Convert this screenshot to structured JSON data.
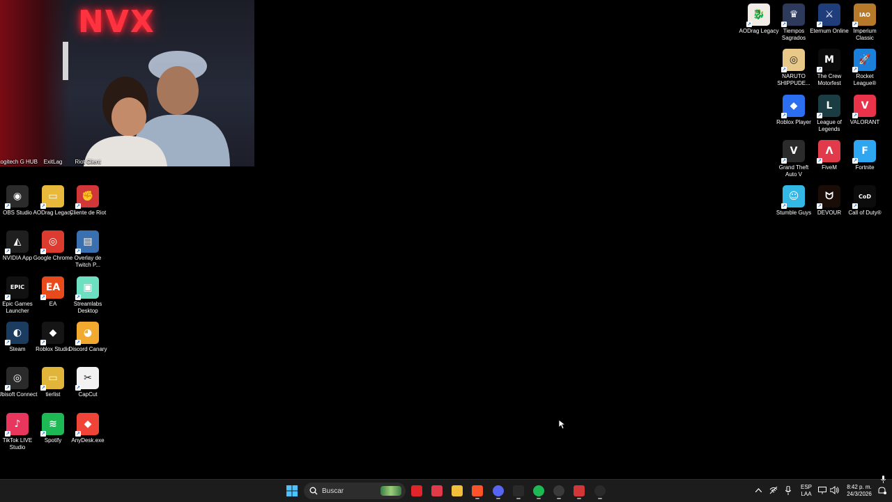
{
  "webcam": {
    "neon_sign": "NVX"
  },
  "left_icons": [
    {
      "label": "Logitech G HUB",
      "color": "#0a0a0a",
      "glyph": "G"
    },
    {
      "label": "ExitLag",
      "color": "#1a1a1a",
      "glyph": "X"
    },
    {
      "label": "Riot Client",
      "color": "#d13639",
      "glyph": "R"
    },
    {
      "label": "OBS Studio",
      "color": "#2b2b2b",
      "glyph": "◉"
    },
    {
      "label": "AODrag Legacy",
      "color": "#e8b93a",
      "glyph": "▭"
    },
    {
      "label": "Cliente de Riot",
      "color": "#d13639",
      "glyph": "✊"
    },
    {
      "label": "NVIDIA App",
      "color": "#1f1f1f",
      "glyph": "◭"
    },
    {
      "label": "Google Chrome",
      "color": "#dd3b30",
      "glyph": "◎"
    },
    {
      "label": "Overlay de Twitch P...",
      "color": "#3a6fb0",
      "glyph": "▤"
    },
    {
      "label": "Epic Games Launcher",
      "color": "#111111",
      "glyph": "EPIC"
    },
    {
      "label": "EA",
      "color": "#e84a1c",
      "glyph": "EA"
    },
    {
      "label": "Streamlabs Desktop",
      "color": "#6ee0c2",
      "glyph": "▣"
    },
    {
      "label": "Steam",
      "color": "#1b3c5f",
      "glyph": "◐"
    },
    {
      "label": "Roblox Studio",
      "color": "#151515",
      "glyph": "◆"
    },
    {
      "label": "Discord Canary",
      "color": "#f2a930",
      "glyph": "◕"
    },
    {
      "label": "Ubisoft Connect",
      "color": "#2a2a2a",
      "glyph": "◎"
    },
    {
      "label": "tierlist",
      "color": "#e0b53a",
      "glyph": "▭"
    },
    {
      "label": "CapCut",
      "color": "#f2f2f2",
      "glyph": "✂"
    },
    {
      "label": "TikTok LIVE Studio",
      "color": "#e8365d",
      "glyph": "♪"
    },
    {
      "label": "Spotify",
      "color": "#1db954",
      "glyph": "≋"
    },
    {
      "label": "AnyDesk.exe",
      "color": "#ef4437",
      "glyph": "◆"
    }
  ],
  "right_icons": [
    {
      "label": "AODrag Legacy",
      "color": "#f1ede6",
      "glyph": "🐉"
    },
    {
      "label": "Tiempos Sagrados",
      "color": "#2d3a5c",
      "glyph": "♛"
    },
    {
      "label": "Eternum Online",
      "color": "#1e3d7a",
      "glyph": "⚔"
    },
    {
      "label": "Imperium Classic",
      "color": "#b67a2a",
      "glyph": "IAO"
    },
    {
      "label": "NARUTO SHIPPUDE...",
      "color": "#e9c98a",
      "glyph": "◎"
    },
    {
      "label": "The Crew Motorfest",
      "color": "#0b0b0b",
      "glyph": "M"
    },
    {
      "label": "Rocket League®",
      "color": "#1a80d9",
      "glyph": "🚀"
    },
    {
      "label": "Roblox Player",
      "color": "#2c6ef0",
      "glyph": "◆"
    },
    {
      "label": "League of Legends",
      "color": "#1a3d44",
      "glyph": "L"
    },
    {
      "label": "VALORANT",
      "color": "#e8334a",
      "glyph": "V"
    },
    {
      "label": "Grand Theft Auto V",
      "color": "#2b2b2b",
      "glyph": "V"
    },
    {
      "label": "FiveM",
      "color": "#e13a4b",
      "glyph": "Λ"
    },
    {
      "label": "Fortnite",
      "color": "#2fa6f2",
      "glyph": "F"
    },
    {
      "label": "Stumble Guys",
      "color": "#33b8e6",
      "glyph": "☺"
    },
    {
      "label": "DEVOUR",
      "color": "#1a0d07",
      "glyph": "ᗢ"
    },
    {
      "label": "Call of Duty®",
      "color": "#0c0c0c",
      "glyph": "CoD"
    }
  ],
  "taskbar": {
    "search_placeholder": "Buscar",
    "language_top": "ESP",
    "language_bottom": "LAA",
    "time": "8:42 p. m.",
    "date": "24/3/2026",
    "apps": [
      {
        "name": "youtube-icon",
        "color": "#e0262a"
      },
      {
        "name": "fivem-icon",
        "color": "#e13a4b"
      },
      {
        "name": "file-explorer-icon",
        "color": "#f0c03a"
      },
      {
        "name": "brave-icon",
        "color": "#fb542b"
      },
      {
        "name": "discord-icon",
        "color": "#5865f2"
      },
      {
        "name": "exitlag-icon",
        "color": "#2a2a2a"
      },
      {
        "name": "spotify-icon",
        "color": "#1db954"
      },
      {
        "name": "obs-icon",
        "color": "#3a3a3a"
      },
      {
        "name": "riot-client-icon",
        "color": "#d13639"
      },
      {
        "name": "steam-icon",
        "color": "#2a2a2a"
      }
    ]
  }
}
